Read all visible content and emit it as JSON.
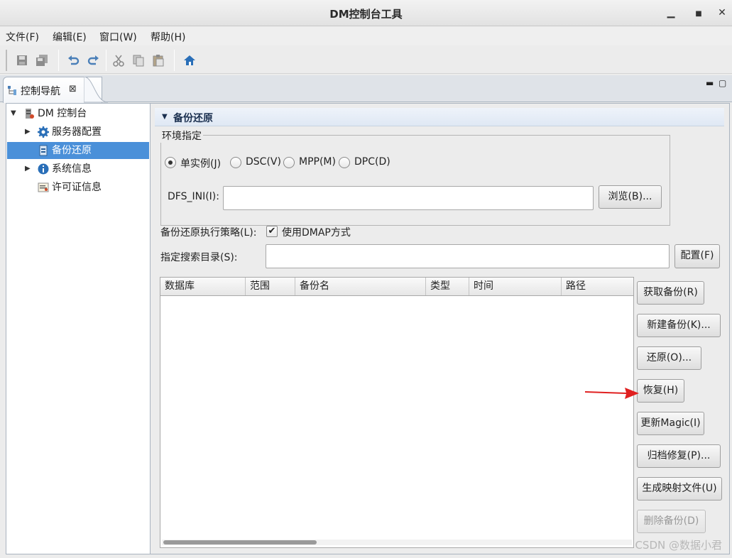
{
  "window": {
    "title": "DM控制台工具",
    "min": "▪",
    "max": "▫",
    "close": "✕"
  },
  "menu": [
    "文件(F)",
    "编辑(E)",
    "窗口(W)",
    "帮助(H)"
  ],
  "toolbar": {
    "icons": [
      "save-icon",
      "save-all-icon",
      "undo-icon",
      "redo-icon",
      "cut-icon",
      "copy-icon",
      "paste-icon",
      "home-icon"
    ]
  },
  "tab": {
    "label": "控制导航",
    "close": "⊠"
  },
  "view_controls": {
    "minimize": "▭",
    "maximize": "▢"
  },
  "nav": {
    "root": "DM 控制台",
    "items": [
      "服务器配置",
      "备份还原",
      "系统信息",
      "许可证信息"
    ],
    "selected": "备份还原"
  },
  "section": {
    "title": "备份还原"
  },
  "env": {
    "legend": "环境指定",
    "radios": [
      "单实例(J)",
      "DSC(V)",
      "MPP(M)",
      "DPC(D)"
    ],
    "selected": "单实例(J)",
    "dfs_label": "DFS_INI(I):",
    "dfs_value": "",
    "browse": "浏览(B)..."
  },
  "strategy": {
    "label": "备份还原执行策略(L):",
    "checkbox_label": "使用DMAP方式",
    "checked": true
  },
  "search_dir": {
    "label": "指定搜索目录(S):",
    "value": "",
    "config": "配置(F)"
  },
  "table": {
    "columns": [
      "数据库",
      "范围",
      "备份名",
      "类型",
      "时间",
      "路径"
    ],
    "rows": []
  },
  "actions": [
    "获取备份(R)",
    "新建备份(K)...",
    "还原(O)...",
    "恢复(H)",
    "更新Magic(I)",
    "归档修复(P)...",
    "生成映射文件(U)",
    "删除备份(D)"
  ],
  "watermark": "CSDN @数据小君",
  "colors": {
    "selection": "#4a90d9",
    "annotation_arrow": "#e02020"
  }
}
